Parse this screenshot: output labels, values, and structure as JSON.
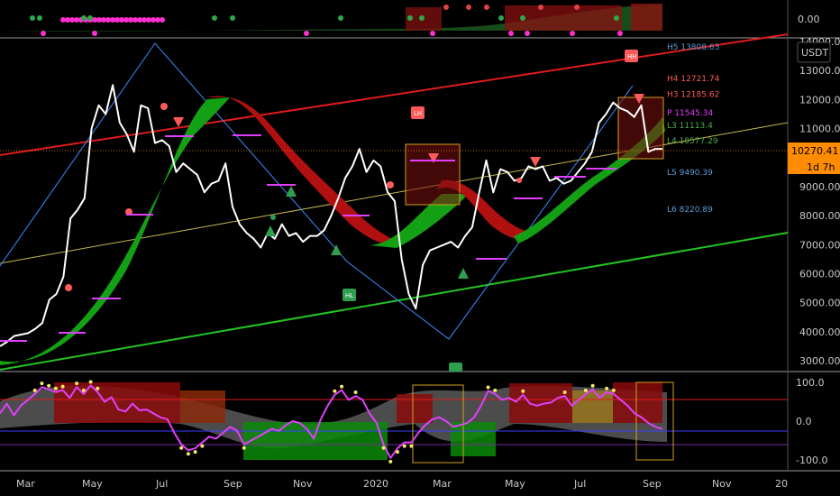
{
  "chart_data": {
    "type": "line",
    "symbol_unit": "USDT",
    "last_price": "10270.41",
    "countdown": "1d 7h",
    "top_panel_value": "0.00",
    "x_ticks": [
      "Mar",
      "May",
      "Jul",
      "Sep",
      "Nov",
      "2020",
      "Mar",
      "May",
      "Jul",
      "Sep",
      "Nov",
      "20"
    ],
    "y_ticks": [
      "14000.00",
      "13000.00",
      "12000.00",
      "11000.00",
      "10000.00",
      "9000.00",
      "8000.00",
      "7000.00",
      "6000.00",
      "5000.00",
      "4000.00",
      "3000.00"
    ],
    "osc_ticks": [
      "100.0",
      "0.0",
      "-100.0"
    ],
    "pivot_levels": [
      {
        "label": "H5 13808.63",
        "color": "#5b9bd5"
      },
      {
        "label": "H4 12721.74",
        "color": "#ff5a5a"
      },
      {
        "label": "H3 12185.62",
        "color": "#ff5a5a"
      },
      {
        "label": "P 11545.34",
        "color": "#e040fb"
      },
      {
        "label": "L3 11113.4",
        "color": "#4caf50"
      },
      {
        "label": "L4 10577.29",
        "color": "#4caf50"
      },
      {
        "label": "L5 9490.39",
        "color": "#5b9bd5"
      },
      {
        "label": "L6 8220.89",
        "color": "#5b9bd5"
      }
    ],
    "price_series": [
      3500,
      3650,
      3850,
      3900,
      3950,
      4100,
      4300,
      5100,
      5300,
      5900,
      7900,
      8200,
      8600,
      11000,
      11800,
      11500,
      12500,
      11200,
      10800,
      10200,
      11800,
      11700,
      10500,
      10600,
      10400,
      9500,
      9800,
      9600,
      9400,
      8800,
      9100,
      9200,
      9800,
      8300,
      7700,
      7400,
      7200,
      6900,
      7400,
      7200,
      7700,
      7300,
      7400,
      7100,
      7300,
      7300,
      7500,
      8000,
      8600,
      9300,
      9700,
      10300,
      9500,
      9900,
      9700,
      8800,
      8500,
      6500,
      5300,
      4800,
      6300,
      6800,
      6900,
      7000,
      7100,
      6900,
      7300,
      7600,
      8800,
      9900,
      8800,
      9600,
      9500,
      9200,
      9300,
      9700,
      9600,
      9700,
      9200,
      9300,
      9100,
      9200,
      9500,
      9800,
      10200,
      11200,
      11500,
      11900,
      11700,
      11600,
      11400,
      11800,
      10200,
      10300,
      10300
    ],
    "oscillator_series": [
      20,
      45,
      15,
      40,
      55,
      70,
      88,
      82,
      75,
      80,
      60,
      88,
      70,
      92,
      75,
      50,
      62,
      30,
      25,
      45,
      28,
      30,
      20,
      10,
      5,
      -30,
      -60,
      -75,
      -70,
      -55,
      -40,
      -45,
      -30,
      -15,
      -25,
      -60,
      -50,
      -40,
      -30,
      -20,
      -25,
      -10,
      0,
      -5,
      -20,
      -45,
      5,
      40,
      68,
      80,
      55,
      65,
      55,
      20,
      -5,
      -60,
      -95,
      -70,
      -55,
      -55,
      -30,
      -10,
      5,
      10,
      0,
      -15,
      -10,
      -5,
      10,
      40,
      78,
      70,
      55,
      60,
      50,
      68,
      45,
      40,
      45,
      48,
      60,
      65,
      40,
      55,
      70,
      82,
      60,
      75,
      70,
      55,
      40,
      20,
      10,
      -5,
      -15,
      -20
    ]
  }
}
